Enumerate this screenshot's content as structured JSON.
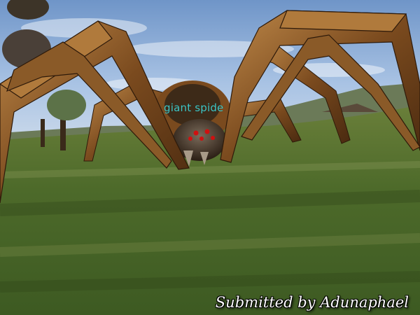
{
  "target": {
    "name": "giant spide",
    "name_color": "#3fc6c6"
  },
  "credit": {
    "text": "Submitted by Adunaphael"
  },
  "colors": {
    "sky": "#8fb0d8",
    "grass": "#4e6a2c",
    "spider_leg": "#8a5a28",
    "spider_eyes": "#cc1010"
  }
}
